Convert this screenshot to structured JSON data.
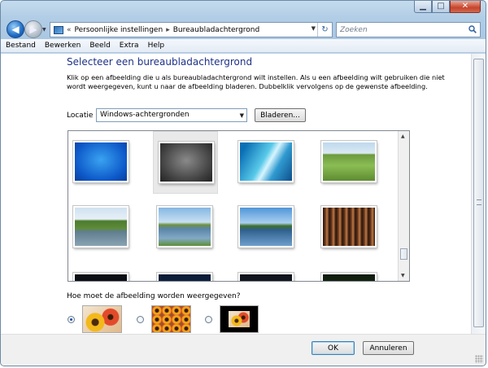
{
  "window": {
    "caption_buttons": {
      "minimize": "▁",
      "maximize": "□",
      "close": "✕"
    }
  },
  "nav": {
    "back_glyph": "◀",
    "forward_glyph": "▶",
    "dropdown_glyph": "▼"
  },
  "address": {
    "chevrons": "«",
    "segments": [
      "Persoonlijke instellingen",
      "Bureaubladachtergrond"
    ],
    "separator": "▸",
    "dropdown_glyph": "▼",
    "refresh_glyph": "↻"
  },
  "search": {
    "placeholder": "Zoeken"
  },
  "menu": {
    "items": [
      "Bestand",
      "Bewerken",
      "Beeld",
      "Extra",
      "Help"
    ]
  },
  "content": {
    "title": "Selecteer een bureaubladachtergrond",
    "description": "Klik op een afbeelding die u als bureaubladachtergrond wilt instellen. Als u een afbeelding wilt gebruiken die niet wordt weergegeven, kunt u naar de afbeelding bladeren. Dubbelklik vervolgens op de gewenste afbeelding.",
    "location_label": "Locatie",
    "location_value": "Windows-achtergronden",
    "browse_label": "Bladeren...",
    "position_question": "Hoe moet de afbeelding worden weergegeven?",
    "selected_tile": 2,
    "selected_position": 1
  },
  "gallery": {
    "scroll_up_glyph": "▲",
    "scroll_down_glyph": "▼"
  },
  "footer": {
    "ok_label": "OK",
    "cancel_label": "Annuleren"
  },
  "colors": {
    "title": "#1e3287",
    "accent": "#1d53a8"
  }
}
